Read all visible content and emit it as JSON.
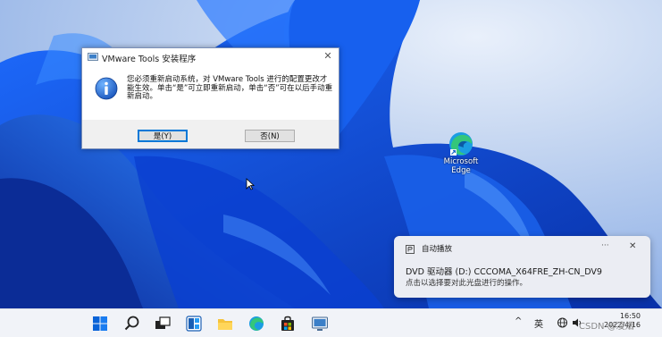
{
  "dialog": {
    "title": "VMware Tools 安装程序",
    "message": "您必须重新启动系统，对 VMware Tools 进行的配置更改才能生效。单击“是”可立即重新启动，单击“否”可在以后手动重新启动。",
    "yes_label": "是(Y)",
    "no_label": "否(N)",
    "close_glyph": "✕"
  },
  "desktop_icons": [
    {
      "label": "Microsoft Edge",
      "icon": "edge-icon"
    }
  ],
  "notification": {
    "app_name": "自动播放",
    "more_glyph": "···",
    "close_glyph": "✕",
    "title": "DVD 驱动器 (D:) CCCOMA_X64FRE_ZH-CN_DV9",
    "body": "点击以选择要对此光盘进行的操作。"
  },
  "taskbar": {
    "apps": [
      "start-icon",
      "search-icon",
      "task-view-icon",
      "widgets-icon",
      "file-explorer-icon",
      "edge-icon",
      "store-icon",
      "vmware-tools-icon"
    ],
    "tray_chevron": "^",
    "ime": "英",
    "time": "16:50",
    "date": "2022/4/16"
  },
  "watermark": "CSDN @凌烟"
}
